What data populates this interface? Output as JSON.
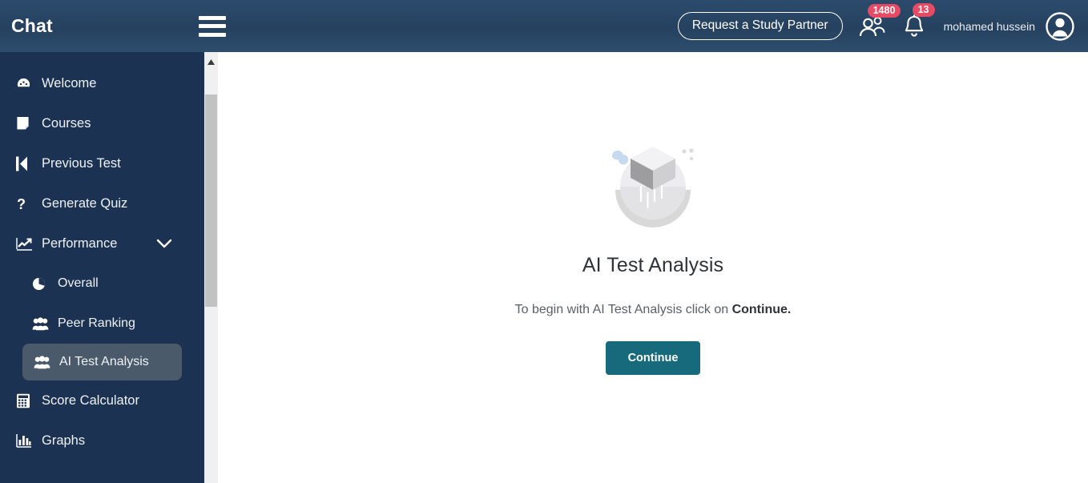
{
  "header": {
    "brand": "Chat",
    "menu_icon": "hamburger-icon",
    "study_partner_label": "Request a Study Partner",
    "people_icon": "people-group-icon",
    "people_badge": "1480",
    "bell_icon": "bell-icon",
    "bell_badge": "13",
    "username": "mohamed hussein",
    "avatar_icon": "user-avatar-icon",
    "bg_color": "#25415f"
  },
  "sidebar": {
    "bg_color": "#1b3252",
    "active_bg_color": "#4a5a6b",
    "items": [
      {
        "label": "Welcome",
        "icon": "dashboard-icon",
        "level": 0,
        "active": false,
        "expandable": false
      },
      {
        "label": "Courses",
        "icon": "book-icon",
        "level": 0,
        "active": false,
        "expandable": false
      },
      {
        "label": "Previous Test",
        "icon": "skip-previous-icon",
        "level": 0,
        "active": false,
        "expandable": false
      },
      {
        "label": "Generate Quiz",
        "icon": "question-mark-icon",
        "level": 0,
        "active": false,
        "expandable": false
      },
      {
        "label": "Performance",
        "icon": "line-chart-icon",
        "level": 0,
        "active": false,
        "expandable": true
      },
      {
        "label": "Overall",
        "icon": "pie-chart-icon",
        "level": 1,
        "active": false,
        "expandable": false
      },
      {
        "label": "Peer Ranking",
        "icon": "users-icon",
        "level": 1,
        "active": false,
        "expandable": false
      },
      {
        "label": "AI Test Analysis",
        "icon": "users-icon",
        "level": 1,
        "active": true,
        "expandable": false
      },
      {
        "label": "Score Calculator",
        "icon": "calculator-icon",
        "level": 0,
        "active": false,
        "expandable": false
      },
      {
        "label": "Graphs",
        "icon": "bar-chart-icon",
        "level": 0,
        "active": false,
        "expandable": false
      }
    ]
  },
  "scrollbar": {
    "up_arrow_icon": "scroll-up-arrow-icon",
    "thumb_color": "#c2c2c2",
    "track_color": "#f0f0f0"
  },
  "main": {
    "illustration_icon": "empty-state-cube-illustration",
    "title": "AI Test Analysis",
    "subtitle_before": "To begin with AI Test Analysis click on ",
    "subtitle_bold": "Continue",
    "subtitle_after": ".",
    "continue_label": "Continue",
    "continue_color": "#176a7c"
  }
}
